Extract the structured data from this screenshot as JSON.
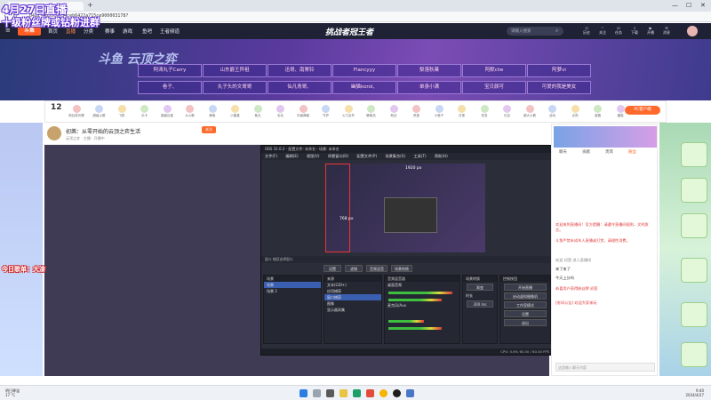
{
  "overlay": {
    "line1": "4月27日直播",
    "line2": "十级粉丝牌或钻粉进群",
    "side_note": "今日歌单：大漆"
  },
  "browser": {
    "url": "…0421-4b55c9754ceb6422a715ce900003178?",
    "window_controls": [
      "—",
      "☐",
      "✕"
    ]
  },
  "site": {
    "logo": "斗鱼",
    "nav": [
      "首页",
      "直播",
      "分类",
      "赛事",
      "游戏",
      "鱼吧",
      "王者频道"
    ],
    "center_title": "挑战者冠王者",
    "search_placeholder": "请输入搜索",
    "header_icons": [
      "历史",
      "关注",
      "任务",
      "下载",
      "开播",
      "消息"
    ]
  },
  "banner": {
    "brand": "斗鱼 云顶之弈",
    "rooms_row1": [
      "阿涛丸子Carry",
      "山东爵王异祖",
      "迅哥、南栗铃",
      "Flancyyy",
      "梨落秋菓",
      "阿默ctw",
      "阿萝vi"
    ],
    "rooms_row2": [
      "卷子、",
      "丸子头的文哥哥",
      "仙凡青哥、",
      "幽猫korol、",
      "单身小满",
      "宝贝颜可",
      "可爱的我是美女"
    ]
  },
  "gifts": {
    "level": "12",
    "items": [
      "粉丝荧光棒",
      "超级火箭",
      "飞机",
      "办卡",
      "超级巨星",
      "大火箭",
      "鲸鱼",
      "小星星",
      "鱼丸",
      "毛毛",
      "中级弹幕",
      "守护",
      "火力全开",
      "鲸鱼岛",
      "粉丝",
      "贵族",
      "小鱼干",
      "日常",
      "任务",
      "礼包",
      "超大火箭",
      "活动",
      "点亮",
      "宝箱",
      "福袋"
    ],
    "pc_client": "PC客户端"
  },
  "room": {
    "title": "初茜：从零开始的云顶之弈生活",
    "follow": "关注",
    "subtitle": "云顶之弈 · 主播 · 开播中"
  },
  "obs": {
    "title": "OBS 31.0.2 - 配置文件: 未命名 - 场景: 未命名",
    "menu": [
      "文件(F)",
      "编辑(E)",
      "视图(V)",
      "停靠窗口(D)",
      "配置文件(P)",
      "场景集合(S)",
      "工具(T)",
      "帮助(H)"
    ],
    "preview_label1": "1920 px",
    "preview_label2": "768 px",
    "control_row": "窗口    捕获选择窗口",
    "buttons": [
      "设置",
      "滤镜",
      "音频混音",
      "场景转换"
    ],
    "scenes_header": "场景",
    "scenes": [
      "场景",
      "场景 2"
    ],
    "sources_header": "来源",
    "sources": [
      "文本(GDI+)",
      "应用捕获",
      "窗口捕获",
      "图像",
      "显示器采集"
    ],
    "mixer_header": "音频混音器",
    "mixer": [
      "桌面音频",
      "麦克风/Aux"
    ],
    "transitions_header": "场景转换",
    "transition_value": "渐变",
    "duration_label": "时长",
    "duration_value": "300 ms",
    "controls_header": "控制按钮",
    "controls": [
      "开始直播",
      "启动虚拟摄像机",
      "工作室模式",
      "设置",
      "退出"
    ],
    "status": "CPU: 0.6%   60.00 / 60.00 FPS"
  },
  "chat": {
    "tabs": [
      "聊天",
      "贡献",
      "贵宾",
      "粉丝"
    ],
    "messages": [
      {
        "user": "系统",
        "text": "欢迎来到直播间！官方提醒：请遵守直播间规则，文明发言。",
        "style": "red"
      },
      {
        "user": "系统",
        "text": "斗鱼严禁未成年人直播或打赏，请理性消费。",
        "style": "red"
      },
      {
        "user": "用户",
        "text": "欢迎 初茜 进入直播间",
        "style": "gray"
      },
      {
        "user": "用户",
        "text": "来了来了",
        "style": "normal"
      },
      {
        "user": "用户",
        "text": "今天上分吗",
        "style": "normal"
      },
      {
        "user": "系统",
        "text": "恭喜用户获得粉丝牌 初茜",
        "style": "red"
      },
      {
        "user": "系统",
        "text": "[房间公告] 欢迎大家来玩",
        "style": "red"
      }
    ],
    "input_placeholder": "这里输入聊天内容"
  },
  "taskbar": {
    "weather": "明日降温",
    "weather_sub": "17 °C",
    "time": "9:40",
    "date": "2024/4/27"
  },
  "colors": {
    "site_nav": "#1f2235",
    "accent": "#ff5d23",
    "banner_purple": "#5a3a9e",
    "obs_bg": "#2b2e38",
    "overlay_stroke": "#5d2fd0"
  }
}
